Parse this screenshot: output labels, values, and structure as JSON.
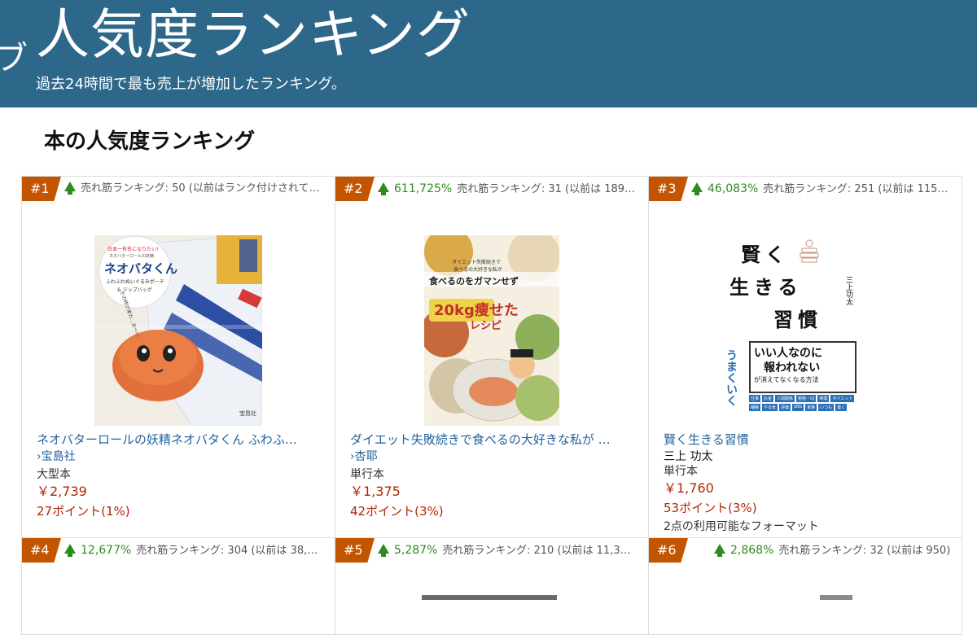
{
  "banner": {
    "side_glyph": "ブ",
    "title": "人気度ランキング",
    "subtitle": "過去24時間で最も売上が増加したランキング。"
  },
  "section": {
    "title": "本の人気度ランキング"
  },
  "colors": {
    "banner": "#2d6789",
    "rank_tag": "#c45500",
    "up_green": "#2e8b1f",
    "link": "#2162a1",
    "price": "#b12704"
  },
  "items": [
    {
      "rank": "#1",
      "pct": "",
      "stat": "売れ筋ランキング: 50 (以前はランク付けされて…",
      "title": "ネオバターロールの妖精ネオバタくん ふわふ…",
      "author": "›宝島社",
      "binding": "大型本",
      "price": "￥2,739",
      "points": "27ポイント(1%)",
      "cover": {
        "l1": "日本一有名になりたい!",
        "l2": "ネオバターロールの妖精",
        "brand": "ネオバタくん",
        "l3": "ふわふわぬいぐるみポーチ",
        "l4": "& ジップバッグ",
        "pub": "宝島社",
        "bubble": "その時が来た…お〜い"
      }
    },
    {
      "rank": "#2",
      "pct": "611,725%",
      "stat": "売れ筋ランキング: 31 (以前は 189…",
      "title": "ダイエット失敗続きで食べるの大好きな私が …",
      "author": "›杏耶",
      "binding": "単行本",
      "price": "￥1,375",
      "points": "42ポイント(3%)",
      "cover": {
        "l1": "ダイエット失敗続きで",
        "l2": "食べるの大好きな私が",
        "main": "食べるのをガマンせず",
        "big": "20kg痩せた",
        "recipe": "レシピ"
      }
    },
    {
      "rank": "#3",
      "pct": "46,083%",
      "stat": "売れ筋ランキング: 251 (以前は 115…",
      "title": "賢く生きる習慣",
      "author": "三上 功太",
      "binding": "単行本",
      "price": "￥1,760",
      "points": "53ポイント(3%)",
      "formats": "2点の利用可能なフォーマット",
      "cover": {
        "t1": "賢く",
        "t2": "生きる",
        "t3": "習慣",
        "author": "三上功太",
        "box1": "いい人なのに",
        "box2": "報われない",
        "box3": "が消えてなくなる方法",
        "side": "うまくいく",
        "tags": [
          "仕事",
          "お金",
          "人間関係",
          "勉強・IQ",
          "時間",
          "ダイエット",
          "睡眠",
          "やる気",
          "評価",
          "SNS",
          "家族",
          "いつも",
          "書く"
        ]
      }
    },
    {
      "rank": "#4",
      "pct": "12,677%",
      "stat": "売れ筋ランキング: 304 (以前は 38,…"
    },
    {
      "rank": "#5",
      "pct": "5,287%",
      "stat": "売れ筋ランキング: 210 (以前は 11,3…"
    },
    {
      "rank": "#6",
      "pct": "2,868%",
      "stat": "売れ筋ランキング: 32 (以前は 950)"
    }
  ]
}
